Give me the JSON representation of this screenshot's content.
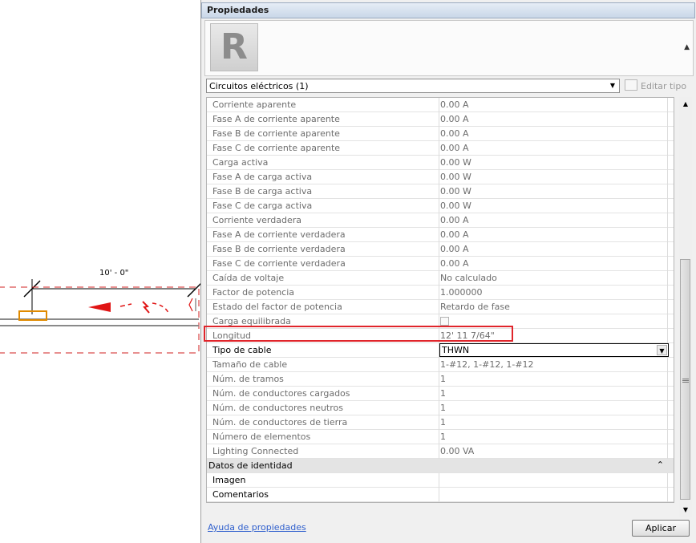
{
  "canvas": {
    "dimension_label": "10' - 0\""
  },
  "panel": {
    "title": "Propiedades",
    "logo_letter": "R",
    "category_selector": "Circuitos eléctricos (1)",
    "edit_type_label": "Editar tipo",
    "rows": [
      {
        "name": "Corriente aparente",
        "value": "0.00 A"
      },
      {
        "name": "Fase A de corriente aparente",
        "value": "0.00 A"
      },
      {
        "name": "Fase B de corriente aparente",
        "value": "0.00 A"
      },
      {
        "name": "Fase C de corriente aparente",
        "value": "0.00 A"
      },
      {
        "name": "Carga activa",
        "value": "0.00 W"
      },
      {
        "name": "Fase A de carga activa",
        "value": "0.00 W"
      },
      {
        "name": "Fase B de carga activa",
        "value": "0.00 W"
      },
      {
        "name": "Fase C de carga activa",
        "value": "0.00 W"
      },
      {
        "name": "Corriente verdadera",
        "value": "0.00 A"
      },
      {
        "name": "Fase A de corriente verdadera",
        "value": "0.00 A"
      },
      {
        "name": "Fase B de corriente verdadera",
        "value": "0.00 A"
      },
      {
        "name": "Fase C de corriente verdadera",
        "value": "0.00 A"
      },
      {
        "name": "Caída de voltaje",
        "value": "No calculado"
      },
      {
        "name": "Factor de potencia",
        "value": "1.000000"
      },
      {
        "name": "Estado del factor de potencia",
        "value": "Retardo de fase"
      },
      {
        "name": "Carga equilibrada",
        "value": ""
      },
      {
        "name": "Longitud",
        "value": "12'  11 7/64\""
      },
      {
        "name": "Tipo de cable",
        "value": "THWN"
      },
      {
        "name": "Tamaño de cable",
        "value": "1-#12, 1-#12, 1-#12"
      },
      {
        "name": "Núm. de tramos",
        "value": "1"
      },
      {
        "name": "Núm. de conductores cargados",
        "value": "1"
      },
      {
        "name": "Núm. de conductores neutros",
        "value": "1"
      },
      {
        "name": "Núm. de conductores de tierra",
        "value": "1"
      },
      {
        "name": "Número de elementos",
        "value": "1"
      },
      {
        "name": "Lighting Connected",
        "value": "0.00 VA"
      }
    ],
    "group_identity": {
      "label": "Datos de identidad",
      "rows": [
        {
          "name": "Imagen",
          "value": ""
        },
        {
          "name": "Comentarios",
          "value": ""
        }
      ]
    },
    "help_link": "Ayuda de propiedades",
    "apply_label": "Aplicar"
  },
  "colors": {
    "highlight": "#e0252b",
    "link": "#2f5fcd",
    "readonly_text": "#6d6d6d"
  }
}
